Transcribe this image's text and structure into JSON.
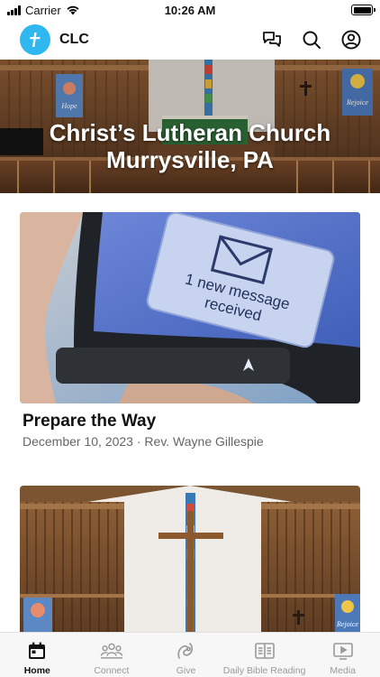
{
  "status_bar": {
    "carrier": "Carrier",
    "time": "10:26 AM",
    "battery_level": 1.0
  },
  "header": {
    "app_name": "CLC",
    "icons": [
      "cross-logo-icon",
      "chat-bubbles-icon",
      "search-icon",
      "profile-icon"
    ]
  },
  "hero": {
    "title_line1": "Christ’s Lutheran Church",
    "title_line2": "Murrysville, PA",
    "banner_left": "Hope",
    "banner_right": "Rejoice"
  },
  "sermons": [
    {
      "title": "Prepare the Way",
      "date": "December 10, 2023",
      "separator": "·",
      "speaker": "Rev. Wayne Gillespie",
      "image_text_line1": "1 new message",
      "image_text_line2": "received"
    },
    {
      "title": "",
      "date": "",
      "speaker": "",
      "banner_right": "Rejoice"
    }
  ],
  "tab_bar": {
    "active": "home",
    "tabs": [
      {
        "id": "home",
        "label": "Home",
        "icon": "calendar-icon"
      },
      {
        "id": "connect",
        "label": "Connect",
        "icon": "group-icon"
      },
      {
        "id": "give",
        "label": "Give",
        "icon": "give-icon"
      },
      {
        "id": "bible",
        "label": "Daily Bible Reading",
        "icon": "book-icon"
      },
      {
        "id": "media",
        "label": "Media",
        "icon": "play-icon"
      }
    ]
  },
  "colors": {
    "accent": "#2fb7f0",
    "tab_inactive": "#9a9a9a",
    "tab_active": "#111111"
  }
}
